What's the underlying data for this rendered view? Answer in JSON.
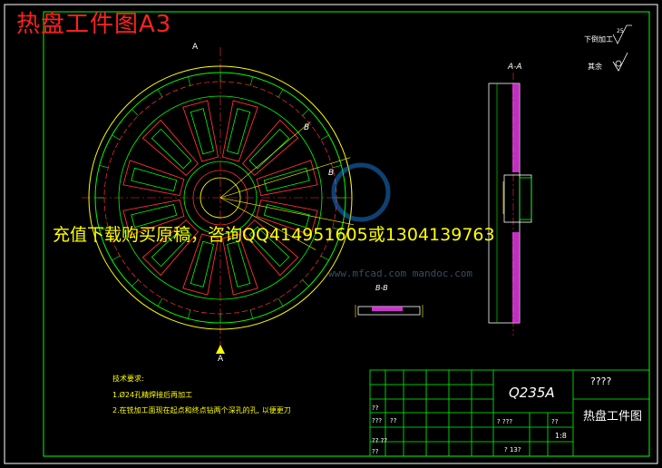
{
  "sheet": {
    "title": "热盘工件图A3",
    "watermark": "充值下载购买原稿，咨询QQ414951605或1304139763",
    "watermark_site": "www.mfcad.com  mandoc.com",
    "colors": {
      "frame": "#00ff00",
      "red": "#ff3030",
      "yellow": "#ffff00",
      "magenta": "#ff40ff",
      "cyan": "#00ffff"
    }
  },
  "views": {
    "main_section_label": "A",
    "aa_label": "A-A",
    "bb_label": "B-B",
    "b_marker": "B",
    "roughness_1": "下倒加工",
    "roughness_1_value": "25",
    "roughness_2": "其余"
  },
  "tech": {
    "heading": "技术要求:",
    "line1": "1.Ø24孔精焊接后再加工",
    "line2": "2.在铣加工面现在起点和终点钻两个深孔的孔, 以便更刀"
  },
  "titleblock": {
    "material": "Q235A",
    "org": "????",
    "drawing_name": "热盘工件图",
    "scale": "1:8",
    "q1": "??",
    "q2": "??",
    "q3": "???",
    "q4": "? ???",
    "q5": "??",
    "q6": "?? ??",
    "q7": "? 13?",
    "q8": "??"
  }
}
